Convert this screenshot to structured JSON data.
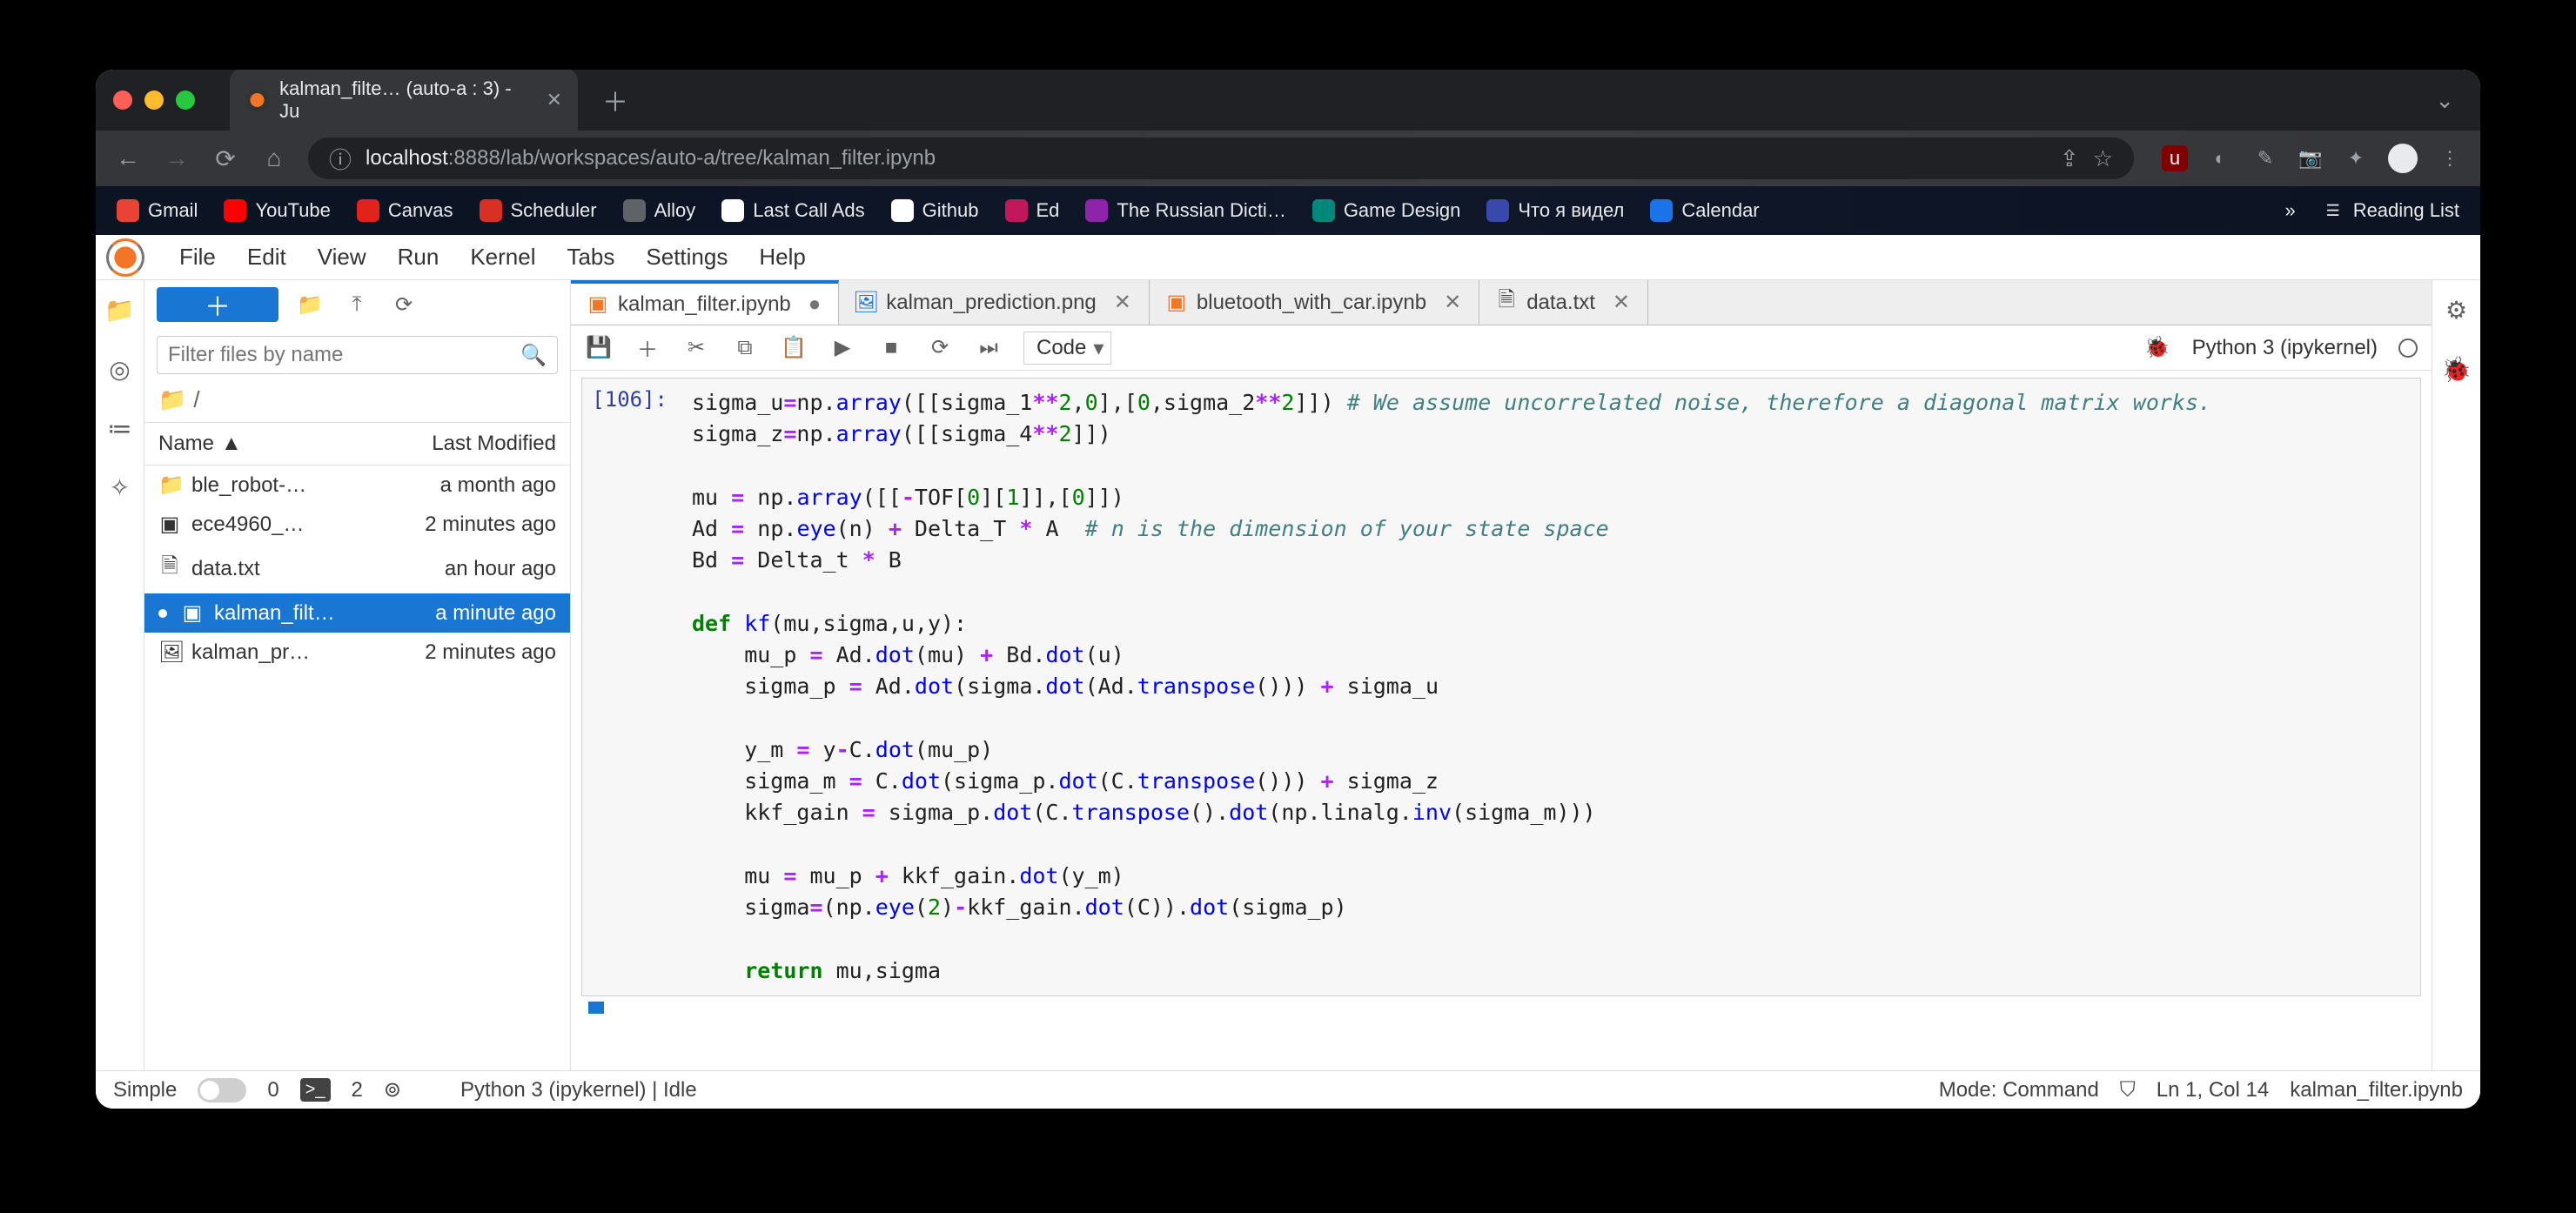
{
  "browser": {
    "tab_title": "kalman_filte… (auto-a : 3) - Ju",
    "url_prefix": "localhost",
    "url_port_path": ":8888/lab/workspaces/auto-a/tree/kalman_filter.ipynb"
  },
  "bookmarks": [
    {
      "label": "Gmail",
      "color": "#ea4335"
    },
    {
      "label": "YouTube",
      "color": "#ff0000"
    },
    {
      "label": "Canvas",
      "color": "#e2231a"
    },
    {
      "label": "Scheduler",
      "color": "#d93025"
    },
    {
      "label": "Alloy",
      "color": "#5f6368"
    },
    {
      "label": "Last Call Ads",
      "color": "#ffffff"
    },
    {
      "label": "Github",
      "color": "#ffffff"
    },
    {
      "label": "Ed",
      "color": "#c2185b"
    },
    {
      "label": "The Russian Dicti…",
      "color": "#8e24aa"
    },
    {
      "label": "Game Design",
      "color": "#00897b"
    },
    {
      "label": "Что я видел",
      "color": "#3949ab"
    },
    {
      "label": "Calendar",
      "color": "#1a73e8"
    }
  ],
  "reading_list": "Reading List",
  "menu": [
    "File",
    "Edit",
    "View",
    "Run",
    "Kernel",
    "Tabs",
    "Settings",
    "Help"
  ],
  "filebrowser": {
    "filter_placeholder": "Filter files by name",
    "path": "/",
    "columns": {
      "name": "Name",
      "modified": "Last Modified"
    },
    "files": [
      {
        "icon": "folder",
        "name": "ble_robot-…",
        "modified": "a month ago",
        "selected": false
      },
      {
        "icon": "notebook",
        "name": "ece4960_…",
        "modified": "2 minutes ago",
        "selected": false
      },
      {
        "icon": "file",
        "name": "data.txt",
        "modified": "an hour ago",
        "selected": false
      },
      {
        "icon": "notebook",
        "name": "kalman_filt…",
        "modified": "a minute ago",
        "selected": true,
        "dirty": true
      },
      {
        "icon": "image",
        "name": "kalman_pr…",
        "modified": "2 minutes ago",
        "selected": false
      }
    ]
  },
  "tabs": [
    {
      "icon": "notebook",
      "label": "kalman_filter.ipynb",
      "active": true,
      "dirty": true
    },
    {
      "icon": "image",
      "label": "kalman_prediction.png",
      "active": false
    },
    {
      "icon": "notebook",
      "label": "bluetooth_with_car.ipynb",
      "active": false
    },
    {
      "icon": "file",
      "label": "data.txt",
      "active": false
    }
  ],
  "nbtoolbar": {
    "cell_type": "Code",
    "kernel": "Python 3 (ipykernel)"
  },
  "cell": {
    "prompt": "[106]:",
    "lines": [
      {
        "t": [
          {
            "s": "sigma_u"
          },
          {
            "s": "=",
            "c": "op"
          },
          {
            "s": "np"
          },
          {
            "s": "."
          },
          {
            "s": "array",
            "c": "builtin"
          },
          {
            "s": "([["
          },
          {
            "s": "sigma_1"
          },
          {
            "s": "**",
            "c": "op"
          },
          {
            "s": "2",
            "c": "num"
          },
          {
            "s": ","
          },
          {
            "s": "0",
            "c": "num"
          },
          {
            "s": "],["
          },
          {
            "s": "0",
            "c": "num"
          },
          {
            "s": ","
          },
          {
            "s": "sigma_2"
          },
          {
            "s": "**",
            "c": "op"
          },
          {
            "s": "2",
            "c": "num"
          },
          {
            "s": "]]) "
          },
          {
            "s": "# We assume uncorrelated noise, therefore a diagonal matrix works.",
            "c": "comment"
          }
        ]
      },
      {
        "t": [
          {
            "s": "sigma_z"
          },
          {
            "s": "=",
            "c": "op"
          },
          {
            "s": "np"
          },
          {
            "s": "."
          },
          {
            "s": "array",
            "c": "builtin"
          },
          {
            "s": "([["
          },
          {
            "s": "sigma_4"
          },
          {
            "s": "**",
            "c": "op"
          },
          {
            "s": "2",
            "c": "num"
          },
          {
            "s": "]])"
          }
        ]
      },
      {
        "t": [
          {
            "s": ""
          }
        ]
      },
      {
        "t": [
          {
            "s": "mu "
          },
          {
            "s": "=",
            "c": "op"
          },
          {
            "s": " np"
          },
          {
            "s": "."
          },
          {
            "s": "array",
            "c": "builtin"
          },
          {
            "s": "([["
          },
          {
            "s": "-",
            "c": "op"
          },
          {
            "s": "TOF["
          },
          {
            "s": "0",
            "c": "num"
          },
          {
            "s": "]["
          },
          {
            "s": "1",
            "c": "num"
          },
          {
            "s": "]],["
          },
          {
            "s": "0",
            "c": "num"
          },
          {
            "s": "]])"
          }
        ]
      },
      {
        "t": [
          {
            "s": "Ad "
          },
          {
            "s": "=",
            "c": "op"
          },
          {
            "s": " np"
          },
          {
            "s": "."
          },
          {
            "s": "eye",
            "c": "builtin"
          },
          {
            "s": "(n) "
          },
          {
            "s": "+",
            "c": "op"
          },
          {
            "s": " Delta_T "
          },
          {
            "s": "*",
            "c": "op"
          },
          {
            "s": " A  "
          },
          {
            "s": "# n is the dimension of your state space",
            "c": "comment"
          }
        ]
      },
      {
        "t": [
          {
            "s": "Bd "
          },
          {
            "s": "=",
            "c": "op"
          },
          {
            "s": " Delta_t "
          },
          {
            "s": "*",
            "c": "op"
          },
          {
            "s": " B"
          }
        ]
      },
      {
        "t": [
          {
            "s": ""
          }
        ]
      },
      {
        "t": [
          {
            "s": "def ",
            "c": "keyword"
          },
          {
            "s": "kf",
            "c": "builtin"
          },
          {
            "s": "(mu,sigma,u,y):"
          }
        ]
      },
      {
        "t": [
          {
            "s": "    mu_p "
          },
          {
            "s": "=",
            "c": "op"
          },
          {
            "s": " Ad"
          },
          {
            "s": "."
          },
          {
            "s": "dot",
            "c": "builtin"
          },
          {
            "s": "(mu) "
          },
          {
            "s": "+",
            "c": "op"
          },
          {
            "s": " Bd"
          },
          {
            "s": "."
          },
          {
            "s": "dot",
            "c": "builtin"
          },
          {
            "s": "(u)"
          }
        ]
      },
      {
        "t": [
          {
            "s": "    sigma_p "
          },
          {
            "s": "=",
            "c": "op"
          },
          {
            "s": " Ad"
          },
          {
            "s": "."
          },
          {
            "s": "dot",
            "c": "builtin"
          },
          {
            "s": "(sigma"
          },
          {
            "s": "."
          },
          {
            "s": "dot",
            "c": "builtin"
          },
          {
            "s": "(Ad"
          },
          {
            "s": "."
          },
          {
            "s": "transpose",
            "c": "builtin"
          },
          {
            "s": "())) "
          },
          {
            "s": "+",
            "c": "op"
          },
          {
            "s": " sigma_u"
          }
        ]
      },
      {
        "t": [
          {
            "s": ""
          }
        ]
      },
      {
        "t": [
          {
            "s": "    y_m "
          },
          {
            "s": "=",
            "c": "op"
          },
          {
            "s": " y"
          },
          {
            "s": "-",
            "c": "op"
          },
          {
            "s": "C"
          },
          {
            "s": "."
          },
          {
            "s": "dot",
            "c": "builtin"
          },
          {
            "s": "(mu_p)"
          }
        ]
      },
      {
        "t": [
          {
            "s": "    sigma_m "
          },
          {
            "s": "=",
            "c": "op"
          },
          {
            "s": " C"
          },
          {
            "s": "."
          },
          {
            "s": "dot",
            "c": "builtin"
          },
          {
            "s": "(sigma_p"
          },
          {
            "s": "."
          },
          {
            "s": "dot",
            "c": "builtin"
          },
          {
            "s": "(C"
          },
          {
            "s": "."
          },
          {
            "s": "transpose",
            "c": "builtin"
          },
          {
            "s": "())) "
          },
          {
            "s": "+",
            "c": "op"
          },
          {
            "s": " sigma_z"
          }
        ]
      },
      {
        "t": [
          {
            "s": "    kkf_gain "
          },
          {
            "s": "=",
            "c": "op"
          },
          {
            "s": " sigma_p"
          },
          {
            "s": "."
          },
          {
            "s": "dot",
            "c": "builtin"
          },
          {
            "s": "(C"
          },
          {
            "s": "."
          },
          {
            "s": "transpose",
            "c": "builtin"
          },
          {
            "s": "()"
          },
          {
            "s": "."
          },
          {
            "s": "dot",
            "c": "builtin"
          },
          {
            "s": "(np"
          },
          {
            "s": "."
          },
          {
            "s": "linalg"
          },
          {
            "s": "."
          },
          {
            "s": "inv",
            "c": "builtin"
          },
          {
            "s": "(sigma_m)))"
          }
        ]
      },
      {
        "t": [
          {
            "s": ""
          }
        ]
      },
      {
        "t": [
          {
            "s": "    mu "
          },
          {
            "s": "=",
            "c": "op"
          },
          {
            "s": " mu_p "
          },
          {
            "s": "+",
            "c": "op"
          },
          {
            "s": " kkf_gain"
          },
          {
            "s": "."
          },
          {
            "s": "dot",
            "c": "builtin"
          },
          {
            "s": "(y_m)"
          }
        ]
      },
      {
        "t": [
          {
            "s": "    sigma"
          },
          {
            "s": "=",
            "c": "op"
          },
          {
            "s": "(np"
          },
          {
            "s": "."
          },
          {
            "s": "eye",
            "c": "builtin"
          },
          {
            "s": "("
          },
          {
            "s": "2",
            "c": "num"
          },
          {
            "s": ")"
          },
          {
            "s": "-",
            "c": "op"
          },
          {
            "s": "kkf_gain"
          },
          {
            "s": "."
          },
          {
            "s": "dot",
            "c": "builtin"
          },
          {
            "s": "(C))"
          },
          {
            "s": "."
          },
          {
            "s": "dot",
            "c": "builtin"
          },
          {
            "s": "(sigma_p)"
          }
        ]
      },
      {
        "t": [
          {
            "s": ""
          }
        ]
      },
      {
        "t": [
          {
            "s": "    "
          },
          {
            "s": "return",
            "c": "keyword"
          },
          {
            "s": " mu,sigma"
          }
        ]
      }
    ]
  },
  "status": {
    "simple": "Simple",
    "terminals": "0",
    "consoles": "2",
    "kernel": "Python 3 (ipykernel) | Idle",
    "mode": "Mode: Command",
    "cursor": "Ln 1, Col 14",
    "file": "kalman_filter.ipynb"
  }
}
